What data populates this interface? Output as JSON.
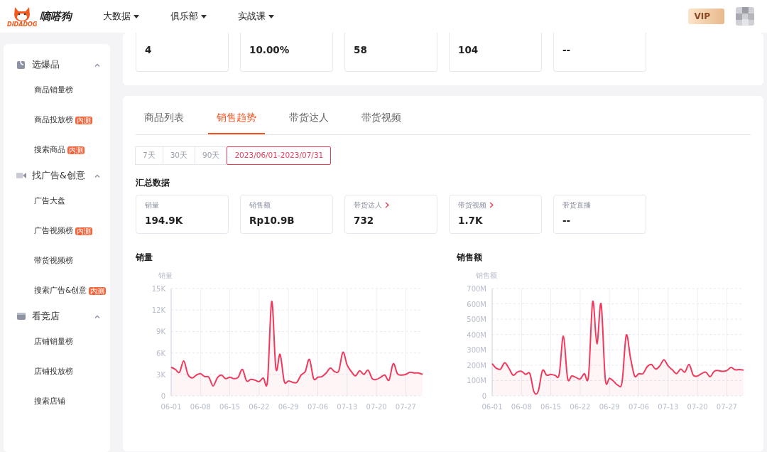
{
  "header": {
    "brand": "嘀嗒狗",
    "logo_caption": "DIDADOG",
    "menus": [
      {
        "label": "大数据"
      },
      {
        "label": "俱乐部"
      },
      {
        "label": "实战课"
      }
    ],
    "vip": "VIP"
  },
  "sidebar": {
    "groups": [
      {
        "label": "选爆品",
        "kind": "bag",
        "expanded": true,
        "items": [
          {
            "label": "商品销量榜"
          },
          {
            "label": "商品投放榜",
            "badge": "内测"
          },
          {
            "label": "搜索商品",
            "badge": "内测"
          }
        ]
      },
      {
        "label": "找广告&创意",
        "kind": "video",
        "expanded": true,
        "items": [
          {
            "label": "广告大盘"
          },
          {
            "label": "广告视频榜",
            "badge": "内测"
          },
          {
            "label": "带货视频榜"
          },
          {
            "label": "搜索广告&创意",
            "badge": "内测"
          }
        ]
      },
      {
        "label": "看竞店",
        "kind": "shop",
        "expanded": true,
        "items": [
          {
            "label": "店铺销量榜"
          },
          {
            "label": "店铺投放榜"
          },
          {
            "label": "搜索店铺"
          }
        ]
      }
    ]
  },
  "overview": {
    "stats": [
      {
        "value": "4"
      },
      {
        "value": "10.00%"
      },
      {
        "value": "58"
      },
      {
        "value": "104"
      },
      {
        "value": "--"
      }
    ]
  },
  "tabs": [
    {
      "label": "商品列表",
      "selected": false
    },
    {
      "label": "销售趋势",
      "selected": true
    },
    {
      "label": "带货达人",
      "selected": false
    },
    {
      "label": "带货视频",
      "selected": false
    }
  ],
  "date_ranges": [
    {
      "label": "7天",
      "selected": false
    },
    {
      "label": "30天",
      "selected": false
    },
    {
      "label": "90天",
      "selected": false
    },
    {
      "label": "2023/06/01-2023/07/31",
      "selected": true
    }
  ],
  "summary": {
    "title": "汇总数据",
    "stats": [
      {
        "label": "销量",
        "value": "194.9K",
        "link": false
      },
      {
        "label": "销售额",
        "value": "Rp10.9B",
        "link": false
      },
      {
        "label": "带货达人",
        "value": "732",
        "link": true
      },
      {
        "label": "带货视频",
        "value": "1.7K",
        "link": true
      },
      {
        "label": "带货直播",
        "value": "--",
        "link": false
      }
    ]
  },
  "charts": [
    {
      "title": "销量",
      "chart_data": {
        "type": "area",
        "ylabel": "销量",
        "grid": true,
        "categories": [
          "06-01",
          null,
          null,
          null,
          null,
          null,
          null,
          "06-08",
          null,
          null,
          null,
          null,
          null,
          null,
          "06-15",
          null,
          null,
          null,
          null,
          null,
          null,
          "06-22",
          null,
          null,
          null,
          null,
          null,
          null,
          "06-29",
          null,
          null,
          null,
          null,
          null,
          null,
          "07-06",
          null,
          null,
          null,
          null,
          null,
          null,
          "07-13",
          null,
          null,
          null,
          null,
          null,
          null,
          "07-20",
          null,
          null,
          null,
          null,
          null,
          null,
          "07-27",
          null,
          null,
          null,
          null
        ],
        "series": [
          {
            "color": "#ef3a5d",
            "values": [
              4.0,
              3.7,
              3.3,
              4.9,
              3.0,
              2.5,
              2.9,
              3.1,
              2.7,
              2.6,
              1.4,
              2.5,
              2.9,
              2.4,
              2.6,
              2.4,
              2.6,
              3.7,
              2.1,
              2.3,
              2.2,
              2.0,
              2.5,
              2.1,
              13.2,
              3.8,
              5.8,
              2.0,
              2.1,
              1.9,
              1.9,
              2.9,
              3.4,
              5.1,
              2.4,
              2.6,
              2.7,
              3.2,
              3.9,
              3.4,
              3.5,
              6.1,
              4.3,
              3.4,
              2.8,
              3.5,
              3.0,
              3.6,
              2.4,
              2.3,
              2.6,
              2.9,
              2.2,
              4.5,
              3.1,
              2.9,
              3.0,
              3.3,
              3.2,
              3.2,
              3.0
            ]
          }
        ],
        "ylim": [
          0,
          15
        ],
        "yticks": [
          {
            "value": 0,
            "label": "0"
          },
          {
            "value": 3,
            "label": "3K"
          },
          {
            "value": 6,
            "label": "6K"
          },
          {
            "value": 9,
            "label": "9K"
          },
          {
            "value": 12,
            "label": "12K"
          },
          {
            "value": 15,
            "label": "15K"
          }
        ]
      }
    },
    {
      "title": "销售额",
      "chart_data": {
        "type": "area",
        "ylabel": "销售额",
        "grid": true,
        "categories": [
          "06-01",
          null,
          null,
          null,
          null,
          null,
          null,
          "06-08",
          null,
          null,
          null,
          null,
          null,
          null,
          "06-15",
          null,
          null,
          null,
          null,
          null,
          null,
          "06-22",
          null,
          null,
          null,
          null,
          null,
          null,
          "06-29",
          null,
          null,
          null,
          null,
          null,
          null,
          "07-06",
          null,
          null,
          null,
          null,
          null,
          null,
          "07-13",
          null,
          null,
          null,
          null,
          null,
          null,
          "07-20",
          null,
          null,
          null,
          null,
          null,
          null,
          "07-27",
          null,
          null,
          null,
          null
        ],
        "series": [
          {
            "color": "#ef3a5d",
            "values": [
              210,
              180,
              175,
              215,
              180,
              135,
              155,
              160,
              140,
              145,
              25,
              30,
              165,
              135,
              140,
              135,
              140,
              390,
              115,
              130,
              120,
              110,
              145,
              130,
              615,
              340,
              600,
              110,
              115,
              95,
              70,
              90,
              395,
              250,
              130,
              145,
              145,
              190,
              205,
              175,
              195,
              235,
              195,
              170,
              145,
              175,
              155,
              205,
              135,
              130,
              145,
              155,
              125,
              160,
              165,
              160,
              165,
              185,
              170,
              172,
              168
            ]
          }
        ],
        "ylim": [
          0,
          700
        ],
        "yticks": [
          {
            "value": 0,
            "label": "0"
          },
          {
            "value": 100,
            "label": "100M"
          },
          {
            "value": 200,
            "label": "200M"
          },
          {
            "value": 300,
            "label": "300M"
          },
          {
            "value": 400,
            "label": "400M"
          },
          {
            "value": 500,
            "label": "500M"
          },
          {
            "value": 600,
            "label": "600M"
          },
          {
            "value": 700,
            "label": "700M"
          }
        ]
      }
    }
  ]
}
